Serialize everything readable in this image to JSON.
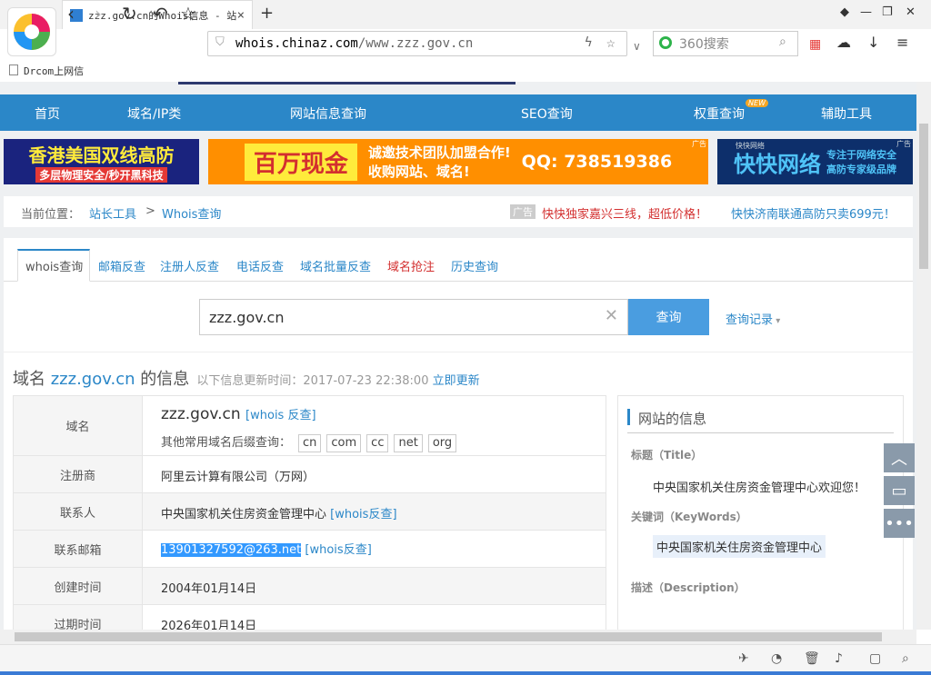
{
  "browser": {
    "tab_title": "zzz.gov.cn的Whois信息 - 站",
    "url_host": "whois.chinaz.com",
    "url_path": "/www.zzz.gov.cn",
    "search_placeholder": "360搜索",
    "bookmark": "Drcom上网信"
  },
  "nav": {
    "items": [
      "首页",
      "域名/IP类",
      "网站信息查询",
      "SEO查询",
      "权重查询",
      "辅助工具"
    ],
    "new_badge": "NEW"
  },
  "banners": {
    "b1_line1": "香港美国双线高防",
    "b1_line2": "多层物理安全/秒开黑科技",
    "b2_main": "百万现金",
    "b2_text": "诚邀技术团队加盟合作!",
    "b2_sub": "收购网站、域名!",
    "b2_qq": "QQ: 738519386",
    "b2_ad": "广告",
    "b3_brand": "快快网络",
    "b3_line1": "专注于网络安全",
    "b3_line2": "高防专家级品牌",
    "b3_small": "快快网络",
    "b3_ad": "广告"
  },
  "breadcrumb": {
    "prefix": "当前位置：",
    "home": "站长工具",
    "sep": ">",
    "current": "Whois查询",
    "ad_label": "广告",
    "ad1": "快快独家嘉兴三线，超低价格！",
    "ad2": "快快济南联通高防只卖699元！"
  },
  "subtabs": [
    "whois查询",
    "邮箱反查",
    "注册人反查",
    "电话反查",
    "域名批量反查",
    "域名抢注",
    "历史查询"
  ],
  "query": {
    "value": "zzz.gov.cn",
    "button": "查询",
    "history": "查询记录"
  },
  "heading": {
    "prefix": "域名 ",
    "domain": "zzz.gov.cn",
    "suffix": " 的信息",
    "update_text": "以下信息更新时间：2017-07-23 22:38:00",
    "update_link": "立即更新"
  },
  "info": {
    "domain_label": "域名",
    "domain_value": "zzz.gov.cn",
    "domain_link": "[whois 反查]",
    "suffix_label": "其他常用域名后缀查询：",
    "suffixes": [
      "cn",
      "com",
      "cc",
      "net",
      "org"
    ],
    "registrar_label": "注册商",
    "registrar_value": "阿里云计算有限公司（万网）",
    "contact_label": "联系人",
    "contact_value": "中央国家机关住房资金管理中心",
    "contact_link": "[whois反查]",
    "email_label": "联系邮箱",
    "email_value": "13901327592@263.net",
    "email_link": "[whois反查]",
    "created_label": "创建时间",
    "created_value": "2004年01月14日",
    "expire_label": "过期时间",
    "expire_value": "2026年01月14日"
  },
  "site_info": {
    "title": "网站的信息",
    "title_label": "标题（Title）",
    "title_value": "中央国家机关住房资金管理中心欢迎您！",
    "keywords_label": "关键词（KeyWords）",
    "keywords_value": "中央国家机关住房资金管理中心",
    "desc_label": "描述（Description）"
  }
}
